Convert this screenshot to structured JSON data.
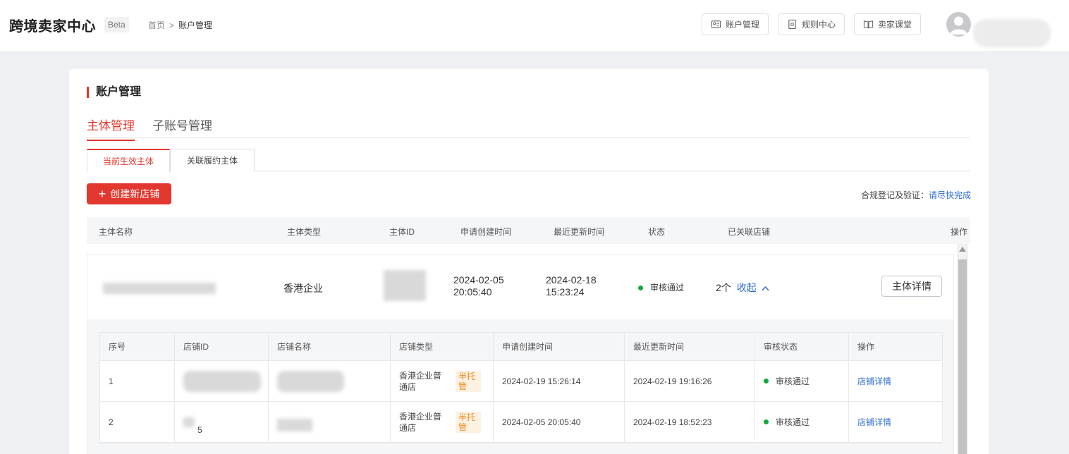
{
  "header": {
    "app_title": "跨境卖家中心",
    "beta": "Beta",
    "breadcrumb": {
      "home": "首页",
      "separator": ">",
      "current": "账户管理"
    },
    "buttons": [
      {
        "label": "账户管理",
        "icon": "id-card-icon"
      },
      {
        "label": "规则中心",
        "icon": "rules-doc-icon"
      },
      {
        "label": "卖家课堂",
        "icon": "book-icon"
      }
    ]
  },
  "page": {
    "section_title": "账户管理",
    "tabs": [
      "主体管理",
      "子账号管理"
    ],
    "active_tab": "主体管理",
    "sub_tabs": [
      "当前生效主体",
      "关联履约主体"
    ],
    "active_sub_tab": "当前生效主体",
    "create_button": "创建新店铺",
    "compliance_label": "合规登记及验证：",
    "compliance_link": "请尽快完成"
  },
  "table": {
    "headers": [
      "主体名称",
      "主体类型",
      "主体ID",
      "申请创建时间",
      "最近更新时间",
      "状态",
      "已关联店铺",
      "操作"
    ],
    "rows": [
      {
        "entity_type": "香港企业",
        "created": "2024-02-05 20:05:40",
        "updated": "2024-02-18 15:23:24",
        "status": "审核通过",
        "stores_count": "2个",
        "collapse_label": "收起",
        "action": "主体详情"
      }
    ]
  },
  "store_table": {
    "headers": [
      "序号",
      "店铺ID",
      "店铺名称",
      "店铺类型",
      "申请创建时间",
      "最近更新时间",
      "审核状态",
      "操作"
    ],
    "rows": [
      {
        "index": "1",
        "type": "香港企业普通店",
        "badge": "半托管",
        "created": "2024-02-19 15:26:14",
        "updated": "2024-02-19 19:16:26",
        "status": "审核通过",
        "action": "店铺详情"
      },
      {
        "index": "2",
        "id_partial": "5",
        "type": "香港企业普通店",
        "badge": "半托管",
        "created": "2024-02-05 20:05:40",
        "updated": "2024-02-19 18:52:23",
        "status": "审核通过",
        "action": "店铺详情"
      }
    ]
  },
  "colors": {
    "accent": "#e2372f",
    "link": "#2e6bd6",
    "success": "#13a83a",
    "badge": "#f08b1a"
  }
}
